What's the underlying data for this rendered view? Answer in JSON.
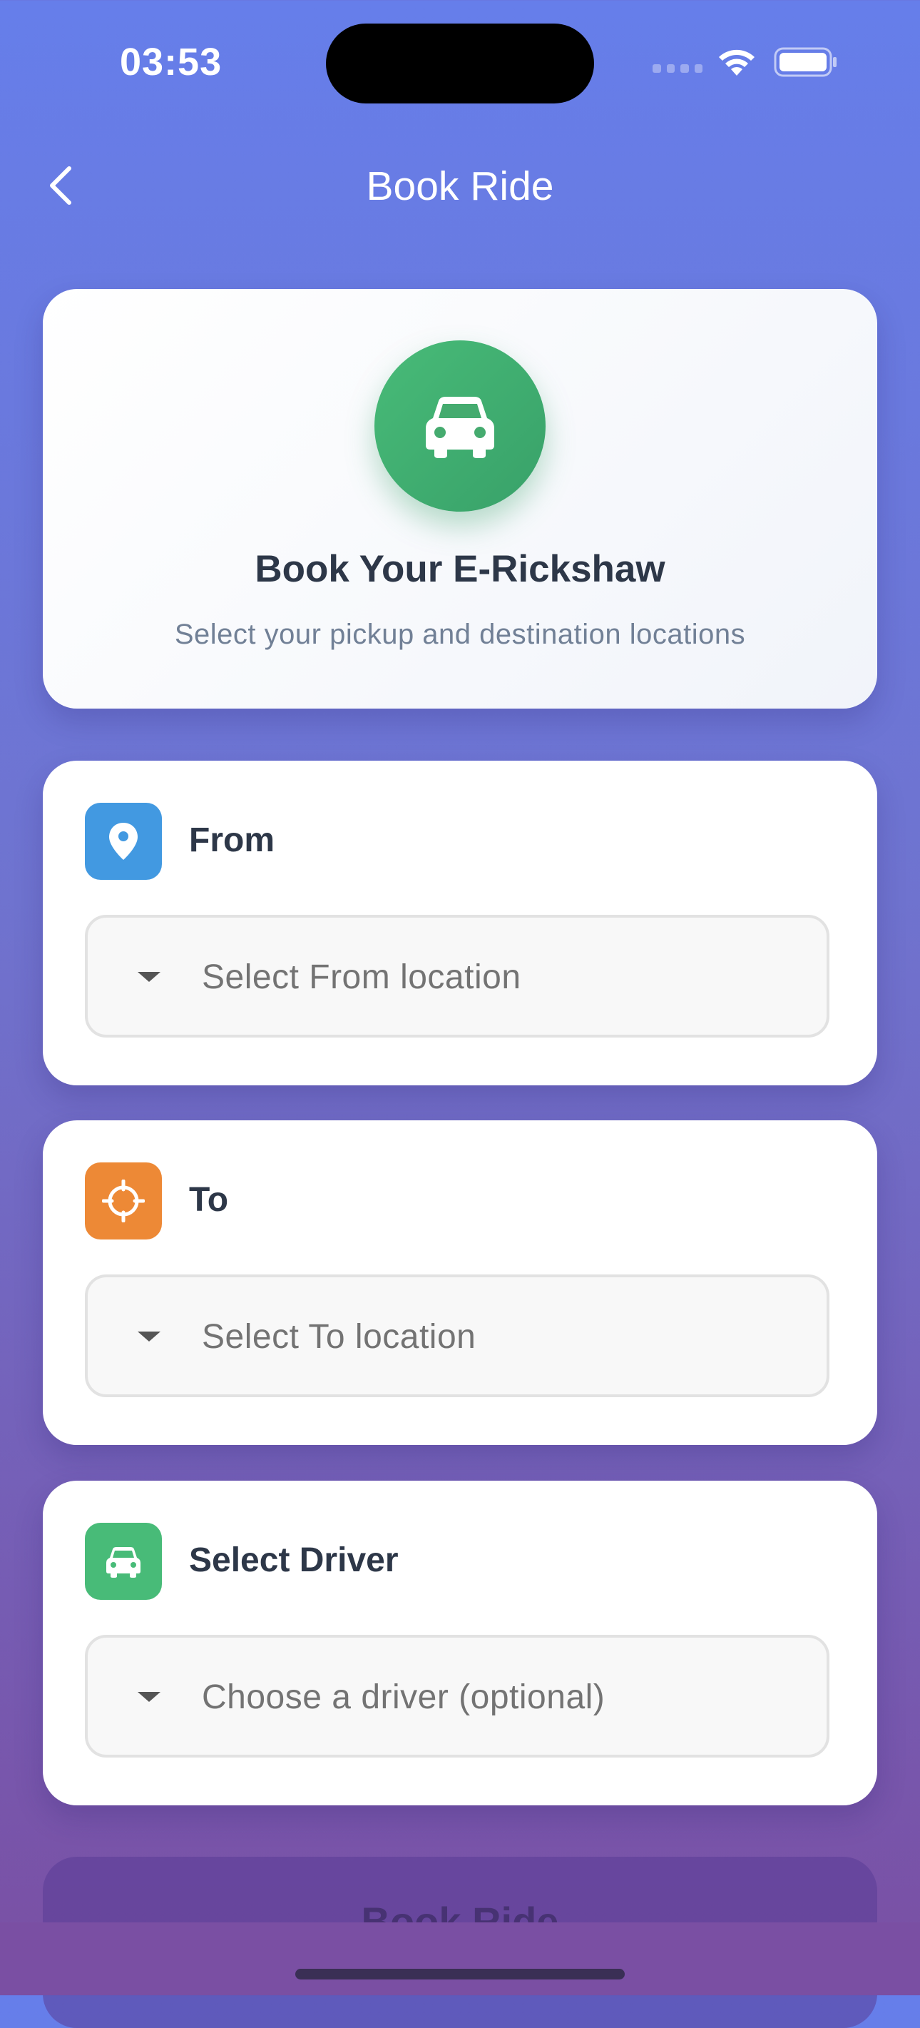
{
  "status_bar": {
    "time": "03:53"
  },
  "header": {
    "title": "Book Ride",
    "back_icon": "chevron-left-icon"
  },
  "hero": {
    "icon": "car-icon",
    "title": "Book Your E-Rickshaw",
    "subtitle": "Select your pickup and destination locations",
    "icon_color": "#48bb78"
  },
  "fields": [
    {
      "label": "From",
      "icon": "map-pin-icon",
      "icon_color": "#4299e1",
      "placeholder": "Select From location"
    },
    {
      "label": "To",
      "icon": "crosshair-icon",
      "icon_color": "#ed8936",
      "placeholder": "Select To location"
    },
    {
      "label": "Select Driver",
      "icon": "car-icon",
      "icon_color": "#48bb78",
      "placeholder": "Choose a driver (optional)"
    }
  ],
  "book_button": {
    "label": "Book Ride"
  },
  "colors": {
    "gradient_top": "#667eea",
    "gradient_bottom": "#764ba2"
  }
}
